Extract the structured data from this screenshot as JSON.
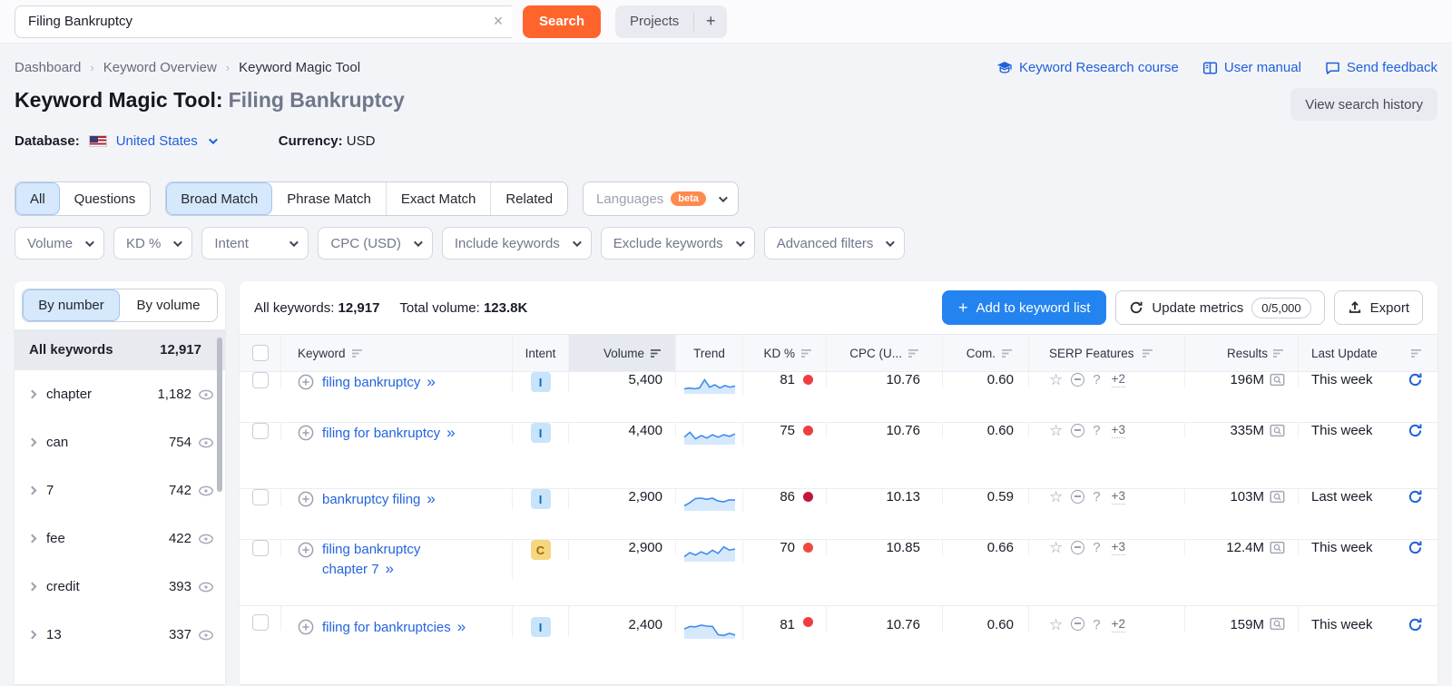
{
  "colors": {
    "accent_orange": "#ff642d",
    "link_blue": "#2060d9",
    "add_button_blue": "#2484ef",
    "trend_line": "#3f8cea",
    "trend_fill": "#d6e9fc",
    "selected_tab_bg": "#d6e8fc"
  },
  "header": {
    "search_value": "Filing Bankruptcy",
    "clear_icon": "×",
    "search_button": "Search",
    "projects_label": "Projects",
    "add_project": "+"
  },
  "breadcrumb": {
    "items": [
      "Dashboard",
      "Keyword Overview",
      "Keyword Magic Tool"
    ],
    "separator": "›"
  },
  "help_links": [
    {
      "label": "Keyword Research course",
      "icon": "graduation-cap"
    },
    {
      "label": "User manual",
      "icon": "book"
    },
    {
      "label": "Send feedback",
      "icon": "chat-bubble"
    }
  ],
  "title": {
    "prefix": "Keyword Magic Tool:",
    "query": "Filing Bankruptcy",
    "history_button": "View search history"
  },
  "meta": {
    "database_label": "Database:",
    "database_value": "United States",
    "currency_label": "Currency:",
    "currency_value": "USD"
  },
  "match_tabs": {
    "group1": [
      {
        "label": "All",
        "selected": true
      },
      {
        "label": "Questions",
        "selected": false
      }
    ],
    "group2": [
      {
        "label": "Broad Match",
        "selected": true
      },
      {
        "label": "Phrase Match",
        "selected": false
      },
      {
        "label": "Exact Match",
        "selected": false
      },
      {
        "label": "Related",
        "selected": false
      }
    ],
    "languages_label": "Languages",
    "beta_badge": "beta"
  },
  "filters": {
    "volume": "Volume",
    "kd": "KD %",
    "intent": "Intent",
    "cpc": "CPC (USD)",
    "include": "Include keywords",
    "exclude": "Exclude keywords",
    "advanced": "Advanced filters"
  },
  "sidebar": {
    "tabs": [
      {
        "label": "By number",
        "selected": true
      },
      {
        "label": "By volume",
        "selected": false
      }
    ],
    "all_row": {
      "label": "All keywords",
      "count": "12,917"
    },
    "items": [
      {
        "label": "chapter",
        "count": "1,182"
      },
      {
        "label": "can",
        "count": "754"
      },
      {
        "label": "7",
        "count": "742"
      },
      {
        "label": "fee",
        "count": "422"
      },
      {
        "label": "credit",
        "count": "393"
      },
      {
        "label": "13",
        "count": "337"
      }
    ]
  },
  "toolbar": {
    "all_keywords_label": "All keywords:",
    "all_keywords_value": "12,917",
    "total_volume_label": "Total volume:",
    "total_volume_value": "123.8K",
    "add_icon": "+",
    "add_button": "Add to keyword list",
    "update_button": "Update metrics",
    "update_quota": "0/5,000",
    "export_button": "Export"
  },
  "table": {
    "columns": {
      "keyword": "Keyword",
      "intent": "Intent",
      "volume": "Volume",
      "trend": "Trend",
      "kd": "KD %",
      "cpc": "CPC (U...",
      "com": "Com.",
      "serp": "SERP Features",
      "results": "Results",
      "last_update": "Last Update"
    },
    "rows": [
      {
        "keyword": "filing bankruptcy",
        "arrow": "»",
        "intent_letter": "I",
        "intent_bg": "#c8e4fb",
        "intent_fg": "#0f62c5",
        "volume": "5,400",
        "trend": [
          2.5,
          3,
          2.5,
          3,
          8,
          3.5,
          5,
          3,
          4.5,
          3.5,
          4.2
        ],
        "kd": "81",
        "kd_color": "#ef3e42",
        "cpc": "10.76",
        "com": "0.60",
        "serp_more": "+2",
        "results": "196M",
        "last_update": "This week"
      },
      {
        "keyword": "filing for bankruptcy",
        "arrow": "»",
        "intent_letter": "I",
        "intent_bg": "#c8e4fb",
        "intent_fg": "#0f62c5",
        "volume": "4,400",
        "trend": [
          4,
          7,
          3,
          5,
          3.5,
          5.5,
          4,
          5.5,
          4.5,
          6
        ],
        "kd": "75",
        "kd_color": "#ef3e42",
        "cpc": "10.76",
        "com": "0.60",
        "serp_more": "+3",
        "results": "335M",
        "last_update": "This week"
      },
      {
        "keyword": "bankruptcy filing",
        "arrow": "»",
        "intent_letter": "I",
        "intent_bg": "#c8e4fb",
        "intent_fg": "#0f62c5",
        "volume": "2,900",
        "trend": [
          2.5,
          4.5,
          7,
          7.2,
          6.5,
          7.2,
          5.5,
          5,
          6.2,
          6
        ],
        "kd": "86",
        "kd_color": "#c2143c",
        "cpc": "10.13",
        "com": "0.59",
        "serp_more": "+3",
        "results": "103M",
        "last_update": "Last week"
      },
      {
        "keyword": "filing bankruptcy chapter 7",
        "arrow": "»",
        "intent_letter": "C",
        "intent_bg": "#f6d780",
        "intent_fg": "#9a6c05",
        "volume": "2,900",
        "trend": [
          2.5,
          5,
          3.5,
          5.5,
          4,
          6.5,
          4.5,
          8.5,
          6.5,
          7.2
        ],
        "kd": "70",
        "kd_color": "#f04a3e",
        "cpc": "10.85",
        "com": "0.66",
        "serp_more": "+3",
        "results": "12.4M",
        "last_update": "This week"
      },
      {
        "keyword": "filing for bankruptcies",
        "arrow": "»",
        "intent_letter": "I",
        "intent_bg": "#c8e4fb",
        "intent_fg": "#0f62c5",
        "volume": "2,400",
        "trend": [
          5.5,
          7,
          6.8,
          7.8,
          7.2,
          7,
          2,
          1.5,
          2.8,
          1.8
        ],
        "kd": "81",
        "kd_color": "#ef3e42",
        "cpc": "10.76",
        "com": "0.60",
        "serp_more": "+2",
        "results": "159M",
        "last_update": "This week"
      }
    ]
  },
  "icons": {
    "star": "☆",
    "question": "?"
  }
}
